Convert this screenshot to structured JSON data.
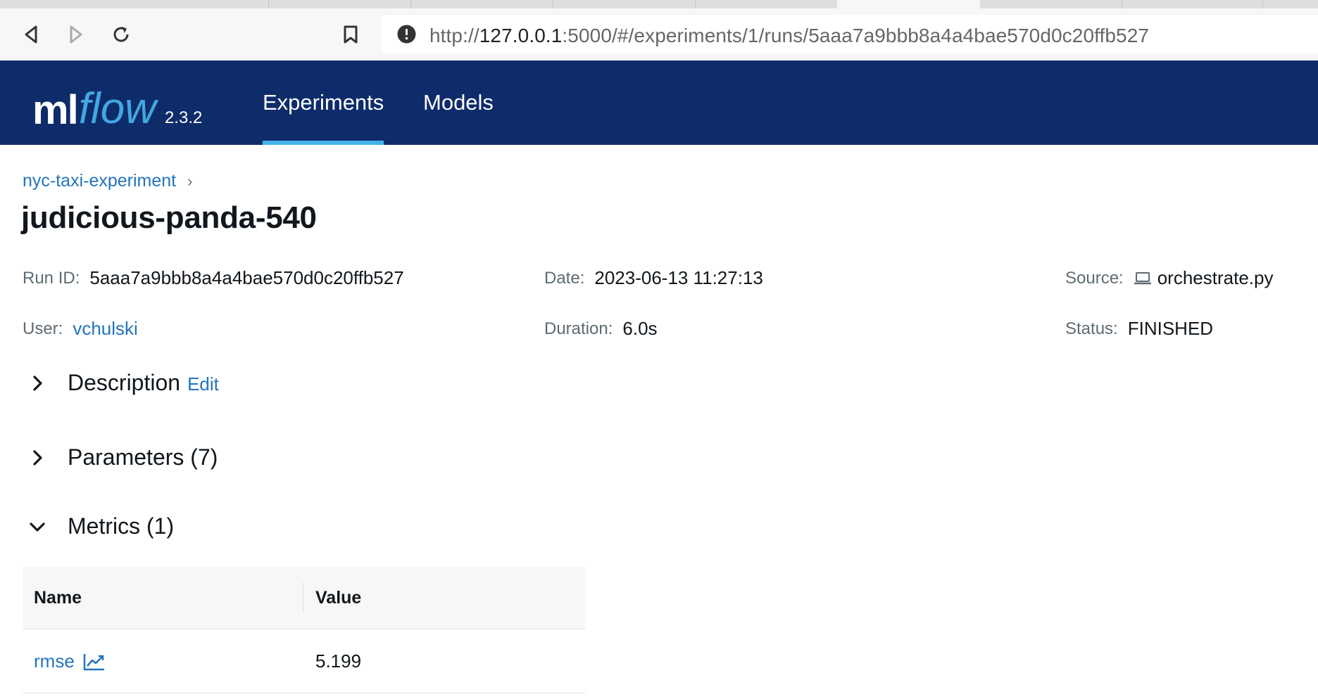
{
  "browser": {
    "url_prefix": "http://",
    "url_host": "127.0.0.1",
    "url_rest": ":5000/#/experiments/1/runs/5aaa7a9bbb8a4a4bae570d0c20ffb527"
  },
  "header": {
    "logo_ml": "ml",
    "logo_flow": "flow",
    "version": "2.3.2",
    "nav": [
      {
        "label": "Experiments",
        "active": true
      },
      {
        "label": "Models",
        "active": false
      }
    ]
  },
  "breadcrumb": {
    "experiment": "nyc-taxi-experiment",
    "separator": "›"
  },
  "run": {
    "title": "judicious-panda-540",
    "run_id_label": "Run ID:",
    "run_id": "5aaa7a9bbb8a4a4bae570d0c20ffb527",
    "date_label": "Date:",
    "date": "2023-06-13 11:27:13",
    "source_label": "Source:",
    "source": "orchestrate.py",
    "user_label": "User:",
    "user": "vchulski",
    "duration_label": "Duration:",
    "duration": "6.0s",
    "status_label": "Status:",
    "status": "FINISHED"
  },
  "sections": {
    "description": {
      "label": "Description",
      "edit": "Edit",
      "expanded": false
    },
    "parameters": {
      "label": "Parameters (7)",
      "expanded": false
    },
    "metrics": {
      "label": "Metrics (1)",
      "expanded": true
    }
  },
  "metrics_table": {
    "columns": [
      "Name",
      "Value"
    ],
    "rows": [
      {
        "name": "rmse",
        "value": "5.199"
      }
    ]
  },
  "colors": {
    "header_bg": "#0e2c6a",
    "accent": "#43b3e6",
    "link": "#2374bb"
  }
}
